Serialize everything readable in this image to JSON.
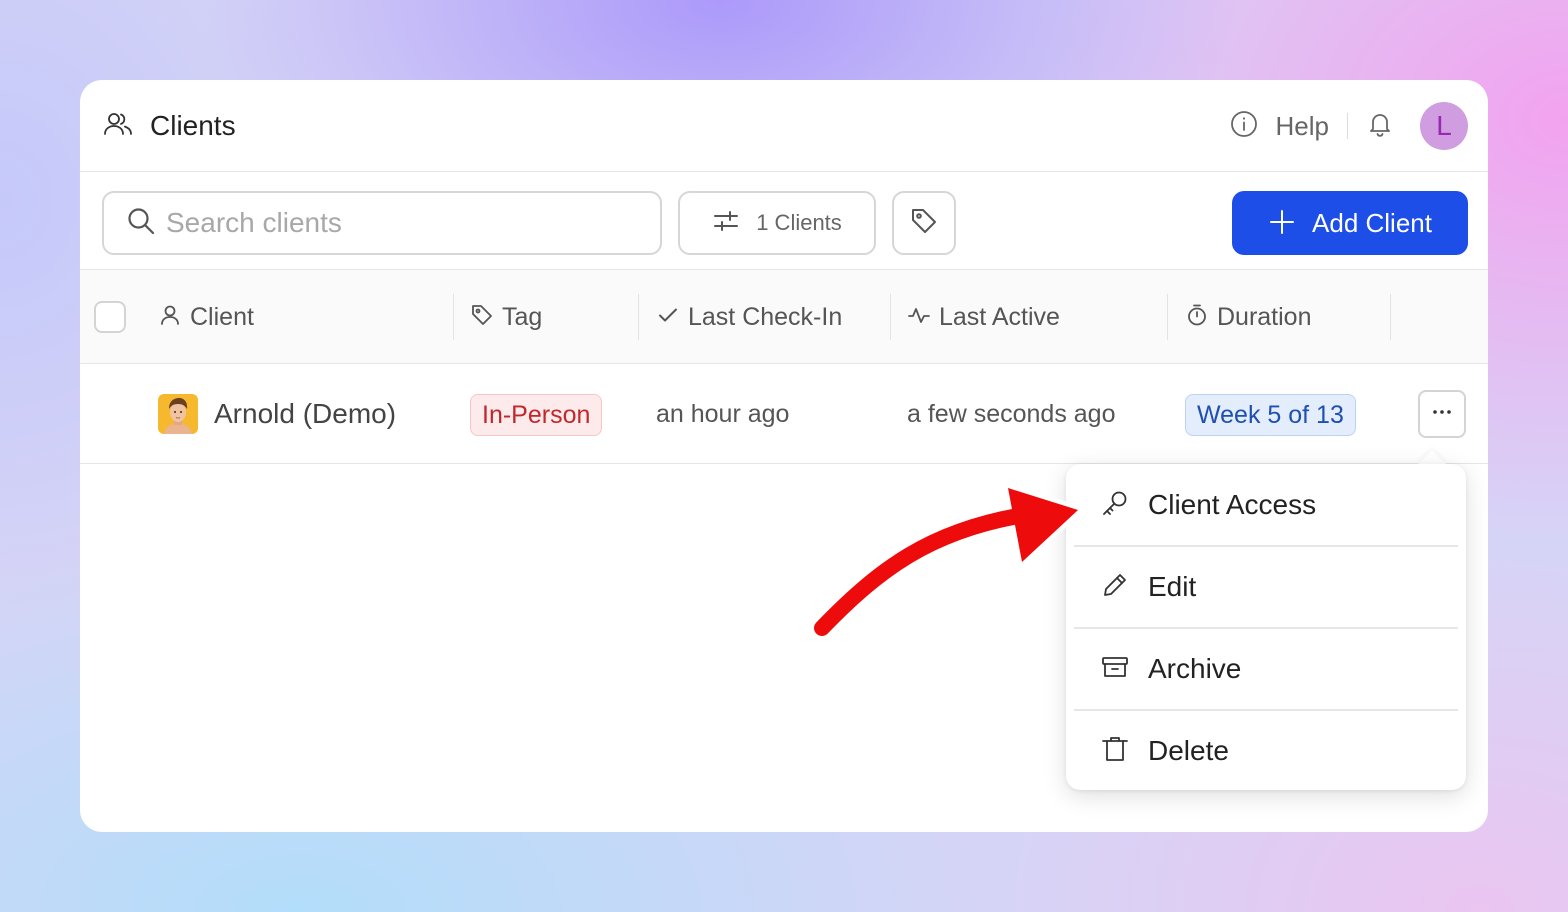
{
  "header": {
    "title": "Clients",
    "help_label": "Help",
    "avatar_initial": "L"
  },
  "toolbar": {
    "search_placeholder": "Search clients",
    "filter_label": "1 Clients",
    "add_label": "Add Client"
  },
  "table": {
    "columns": [
      {
        "label": "Client",
        "icon": "user-icon"
      },
      {
        "label": "Tag",
        "icon": "tag-icon"
      },
      {
        "label": "Last Check-In",
        "icon": "check-icon"
      },
      {
        "label": "Last Active",
        "icon": "activity-icon"
      },
      {
        "label": "Duration",
        "icon": "stopwatch-icon"
      }
    ],
    "rows": [
      {
        "client": "Arnold (Demo)",
        "tag": "In-Person",
        "last_check_in": "an hour ago",
        "last_active": "a few seconds ago",
        "duration": "Week 5 of 13"
      }
    ]
  },
  "menu": {
    "items": [
      {
        "label": "Client Access",
        "icon": "key-icon"
      },
      {
        "label": "Edit",
        "icon": "pencil-icon"
      },
      {
        "label": "Archive",
        "icon": "archive-icon"
      },
      {
        "label": "Delete",
        "icon": "trash-icon"
      }
    ]
  },
  "colors": {
    "primary": "#1d4fe8",
    "tag_bg": "#fdeaea",
    "tag_text": "#c0282d",
    "duration_bg": "#e3edfc",
    "duration_text": "#1f4fb0",
    "avatar_bg": "#cf9de0",
    "arrow": "#ee0b0b"
  }
}
